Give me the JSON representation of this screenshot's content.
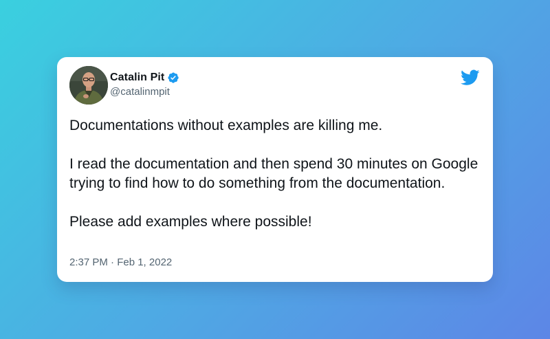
{
  "tweet": {
    "author_name": "Catalin Pit",
    "handle": "@catalinmpit",
    "verified": true,
    "text_lines": [
      "Documentations without examples are killing me.",
      "I read the documentation and then spend 30 minutes on Google trying to find how to do something from the documentation.",
      "Please add examples where possible!"
    ],
    "timestamp": "2:37 PM · Feb 1, 2022"
  },
  "icons": {
    "brand": "twitter-bird-icon",
    "badge": "verified-badge-icon"
  },
  "colors": {
    "background_start": "#3ad0df",
    "background_end": "#5d86e6",
    "card": "#ffffff",
    "twitter_blue": "#1d9bf0",
    "text_primary": "#0f1419",
    "text_secondary": "#536471"
  }
}
